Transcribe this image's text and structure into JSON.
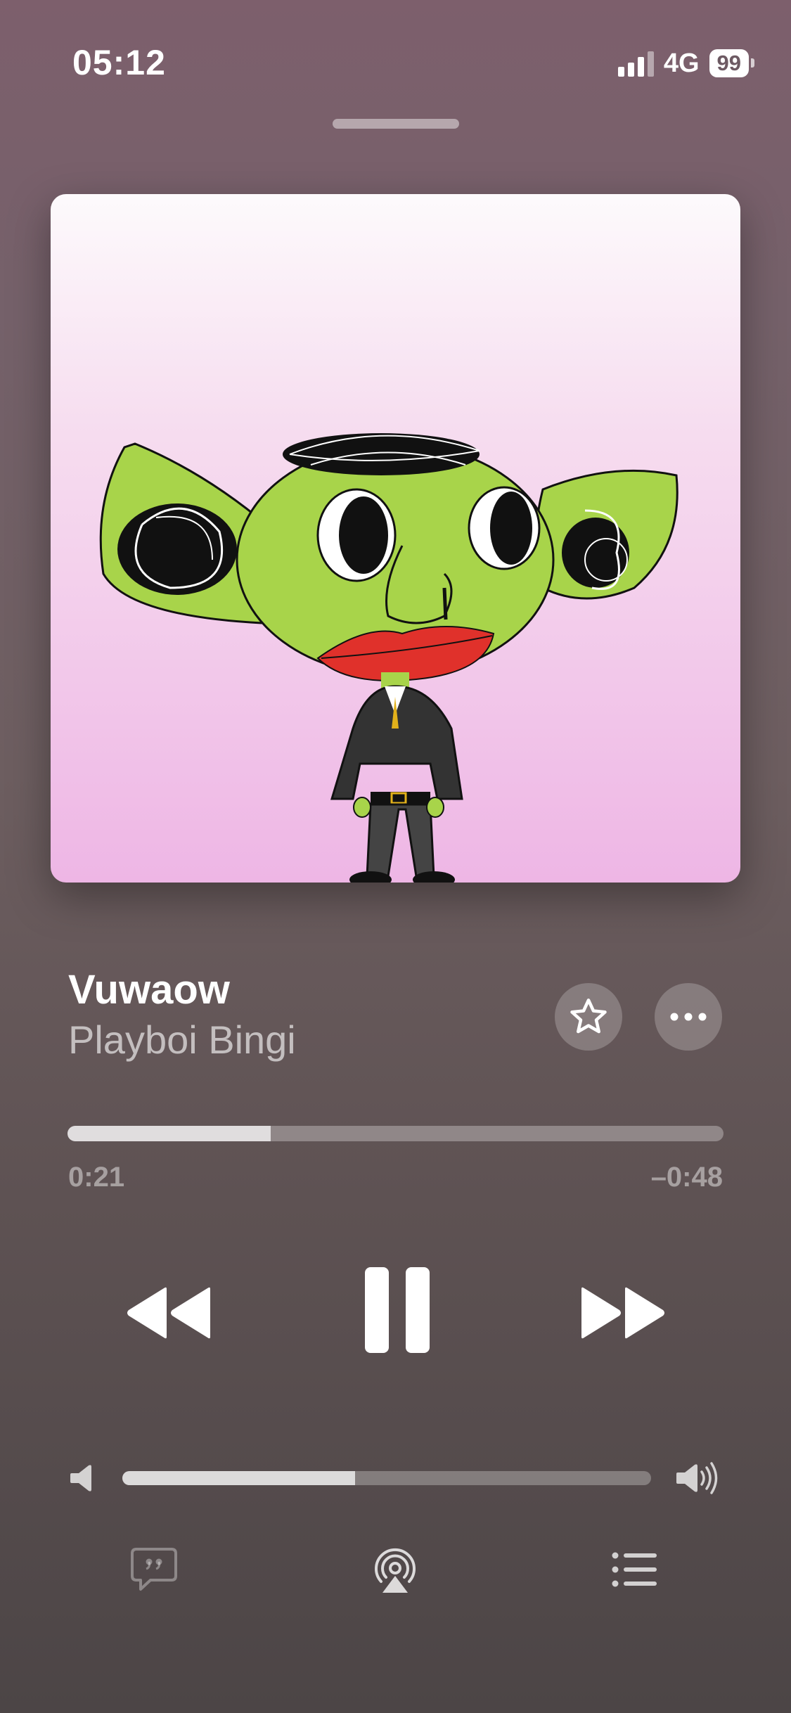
{
  "status_bar": {
    "time": "05:12",
    "network": "4G",
    "battery": "99",
    "signal_bars_active": 3,
    "signal_bars_total": 4
  },
  "now_playing": {
    "title": "Vuwaow",
    "artist": "Playboi Bingi",
    "elapsed": "0:21",
    "remaining": "–0:48",
    "progress_fraction": 0.31,
    "volume_fraction": 0.44
  },
  "controls": {
    "favorite_icon": "star-icon",
    "more_icon": "ellipsis-icon",
    "rewind_icon": "backward-icon",
    "pause_icon": "pause-icon",
    "forward_icon": "forward-icon",
    "lyrics_icon": "quote-bubble-icon",
    "airplay_icon": "airplay-icon",
    "queue_icon": "list-icon"
  },
  "colors": {
    "artwork_bg_top": "#fdfafc",
    "artwork_bg_bottom": "#eeb6e5",
    "character_skin": "#a8d44a",
    "lips": "#e0312b"
  }
}
